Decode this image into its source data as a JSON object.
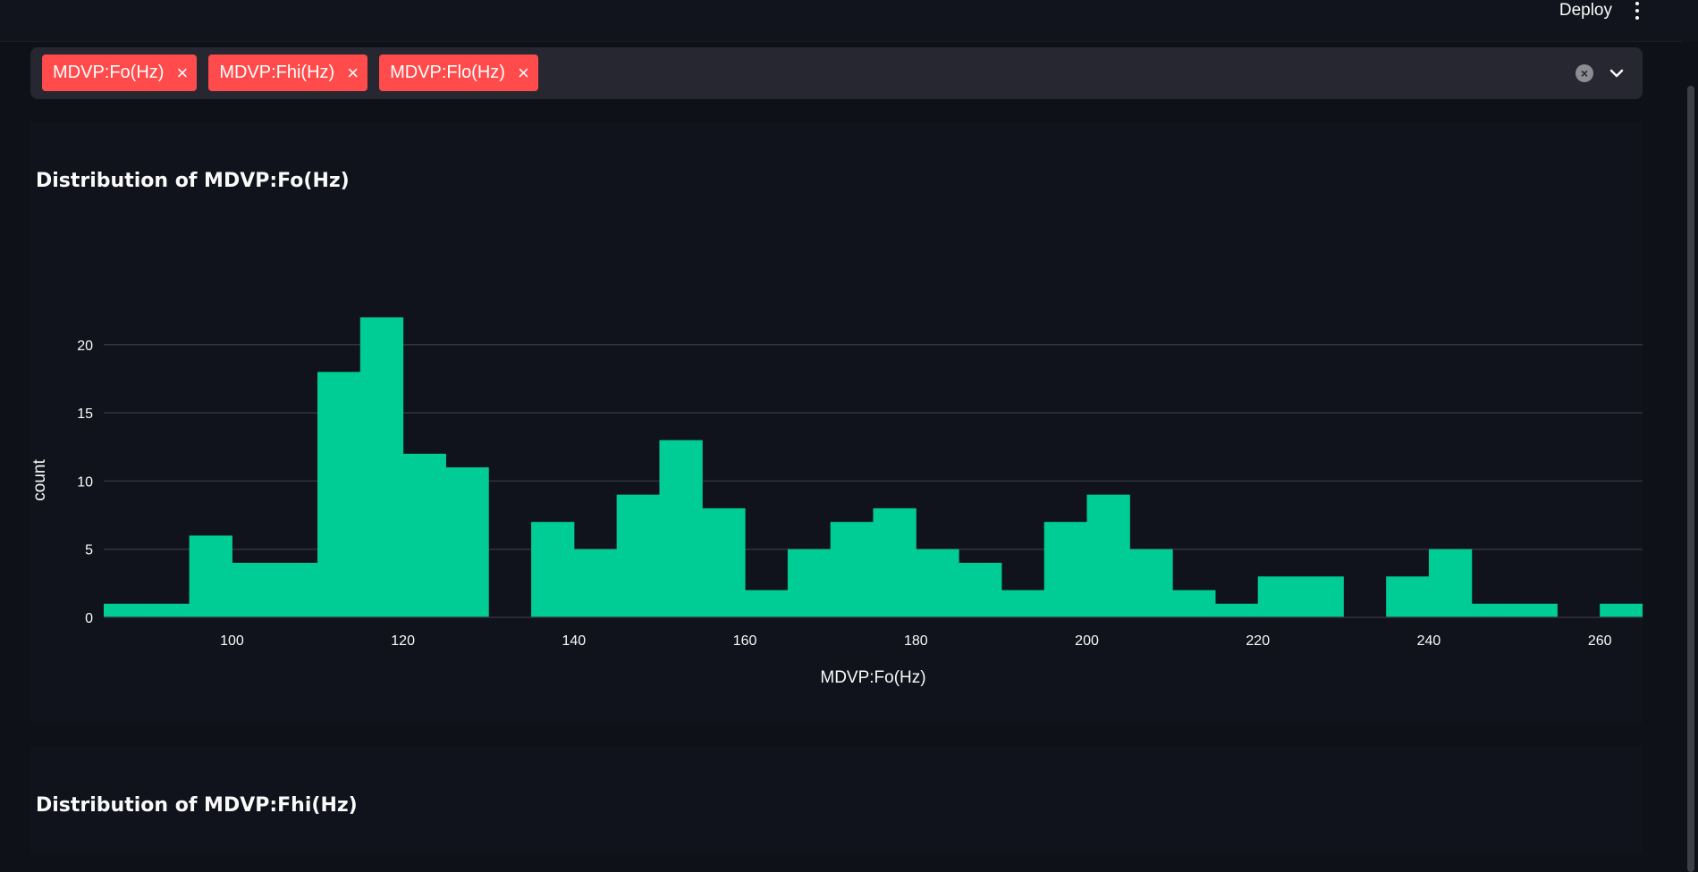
{
  "header": {
    "deploy_label": "Deploy",
    "menu_icon": "kebab-menu-icon"
  },
  "multiselect": {
    "chips": [
      "MDVP:Fo(Hz)",
      "MDVP:Fhi(Hz)",
      "MDVP:Flo(Hz)"
    ],
    "chip_remove_glyph": "×",
    "clear_icon": "clear-all-icon",
    "dropdown_icon": "chevron-down-icon"
  },
  "colors": {
    "accent": "#ff4b4b",
    "bar": "#00cc96",
    "background": "#0e1117"
  },
  "charts": [
    {
      "title": "Distribution of MDVP:Fo(Hz)"
    },
    {
      "title": "Distribution of MDVP:Fhi(Hz)"
    }
  ],
  "chart_data": {
    "type": "bar",
    "title": "Distribution of MDVP:Fo(Hz)",
    "xlabel": "MDVP:Fo(Hz)",
    "ylabel": "count",
    "bin_width": 5,
    "x_bin_starts": [
      85,
      90,
      95,
      100,
      105,
      110,
      115,
      120,
      125,
      130,
      135,
      140,
      145,
      150,
      155,
      160,
      165,
      170,
      175,
      180,
      185,
      190,
      195,
      200,
      205,
      210,
      215,
      220,
      225,
      230,
      235,
      240,
      245,
      250,
      255,
      260
    ],
    "values": [
      1,
      1,
      6,
      4,
      4,
      18,
      22,
      12,
      11,
      0,
      7,
      5,
      9,
      13,
      8,
      2,
      5,
      7,
      8,
      5,
      4,
      2,
      7,
      9,
      5,
      2,
      1,
      3,
      3,
      0,
      3,
      5,
      1,
      1,
      0,
      1
    ],
    "xlim": [
      85,
      265
    ],
    "ylim": [
      0,
      23
    ],
    "x_ticks": [
      100,
      120,
      140,
      160,
      180,
      200,
      220,
      240,
      260
    ],
    "y_ticks": [
      0,
      5,
      10,
      15,
      20
    ],
    "grid": true,
    "legend": "none"
  }
}
